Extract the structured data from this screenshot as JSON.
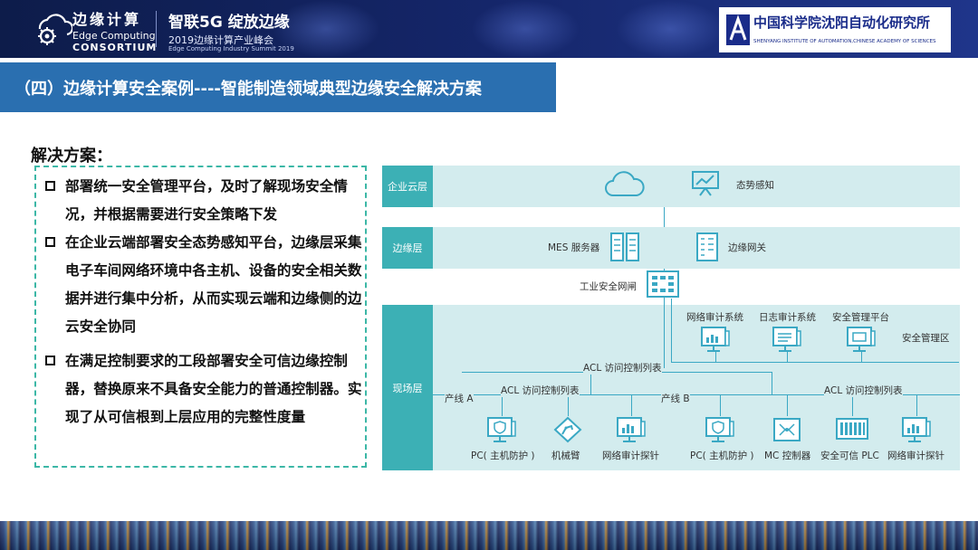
{
  "header": {
    "logo_cn": "边缘计算",
    "logo_en_1": "Edge Computing",
    "logo_en_2": "CONSORTIUM",
    "slogan": "智联5G  绽放边缘",
    "summit_cn": "2019边缘计算产业峰会",
    "summit_en": "Edge Computing Industry Summit 2019",
    "sia_cn": "中国科学院沈阳自动化研究所",
    "sia_en": "SHENYANG INSTITUTE OF AUTOMATION,CHINESE ACADEMY OF SCIENCES"
  },
  "section_title": "（四）边缘计算安全案例----智能制造领域典型边缘安全解决方案",
  "solution": {
    "label": "解决方案：",
    "bullets": [
      "部署统一安全管理平台，及时了解现场安全情况，并根据需要进行安全策略下发",
      "在企业云端部署安全态势感知平台，边缘层采集电子车间网络环境中各主机、设备的安全相关数据并进行集中分析，从而实现云端和边缘侧的边云安全协同",
      "在满足控制要求的工段部署安全可信边缘控制器，替换原来不具备安全能力的普通控制器。实现了从可信根到上层应用的完整性度量"
    ]
  },
  "diagram": {
    "layers": {
      "cloud": "企业云层",
      "edge": "边缘层",
      "field": "现场层"
    },
    "cloud_items": {
      "situation": "态势感知"
    },
    "edge_items": {
      "mes": "MES 服务器",
      "gateway": "边缘网关"
    },
    "firewall": "工业安全网闸",
    "security_zone": "安全管理区",
    "security_items": [
      "网络审计系统",
      "日志审计系统",
      "安全管理平台"
    ],
    "acl_main": "ACL 访问控制列表",
    "acl_a": "ACL 访问控制列表",
    "acl_b": "ACL 访问控制列表",
    "line_a": "产线 A",
    "line_b": "产线 B",
    "devices_a": [
      "PC( 主机防护 )",
      "机械臂",
      "网络审计探针"
    ],
    "devices_b": [
      "PC( 主机防护 )",
      "MC 控制器",
      "安全可信 PLC",
      "网络审计探针"
    ]
  }
}
